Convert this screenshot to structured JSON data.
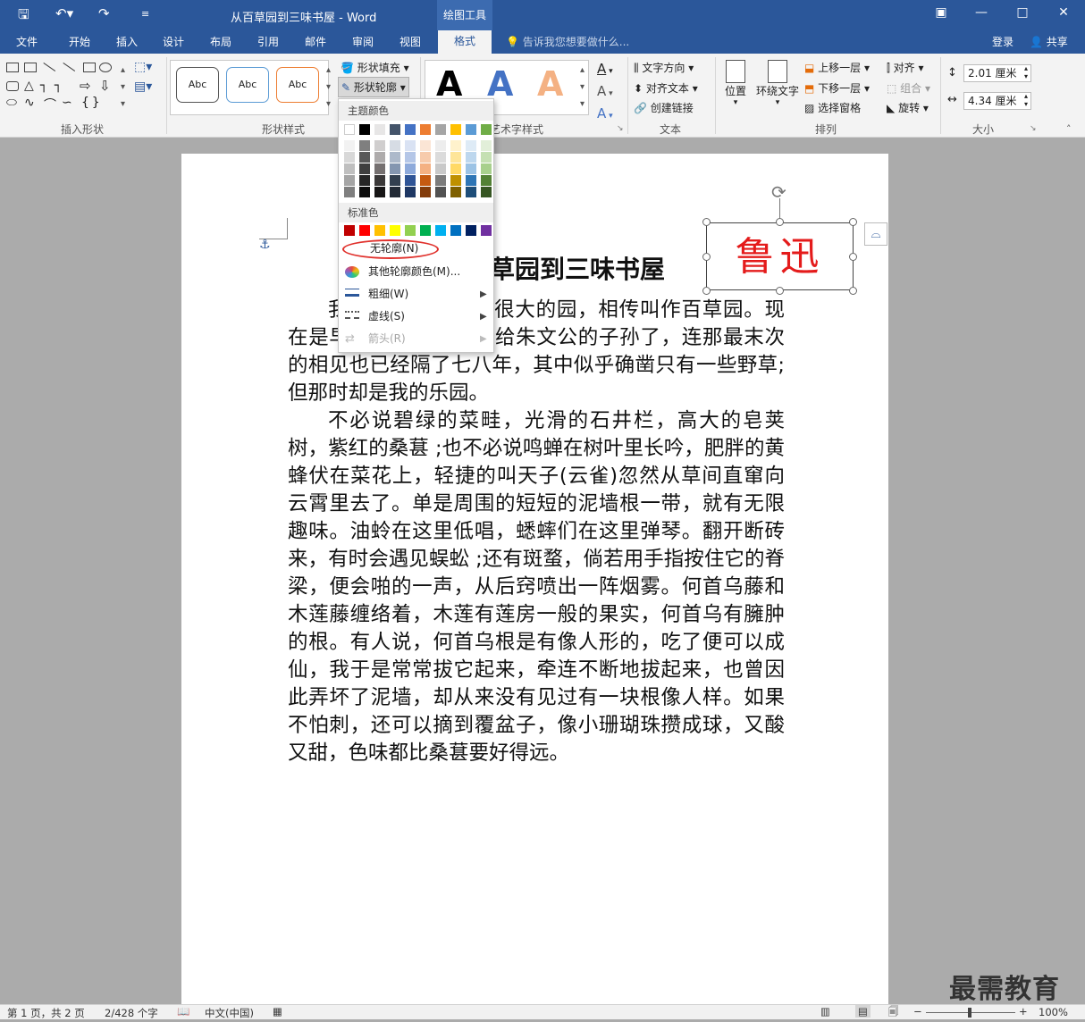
{
  "title_bar": {
    "document_title": "从百草园到三味书屋 - Word",
    "contextual_header": "绘图工具",
    "qat_icons": [
      "save-icon",
      "undo-icon",
      "redo-icon",
      "customize-icon"
    ]
  },
  "tabs": [
    "文件",
    "开始",
    "插入",
    "设计",
    "布局",
    "引用",
    "邮件",
    "审阅",
    "视图"
  ],
  "active_tab": "格式",
  "tell_me": "告诉我您想要做什么...",
  "login": "登录",
  "share": "共享",
  "ribbon": {
    "insert_shapes_label": "插入形状",
    "shape_styles_label": "形状样式",
    "wordart_label": "艺术字样式",
    "text_label": "文本",
    "arrange_label": "排列",
    "size_label": "大小",
    "style_sample": "Abc",
    "style_sample_colors": [
      "#222222",
      "#5b9bd5",
      "#ed7d31"
    ],
    "shape_fill": "形状填充",
    "shape_outline": "形状轮廓",
    "wordart_letter": "A",
    "wordart_colors": [
      "#000000",
      "#4472c4",
      "#f4b183"
    ],
    "text_direction": "文字方向",
    "align_text": "对齐文本",
    "create_link": "创建链接",
    "position": "位置",
    "wrap_text": "环绕文字",
    "bring_forward": "上移一层",
    "send_backward": "下移一层",
    "selection_pane": "选择窗格",
    "align": "对齐",
    "group": "组合",
    "rotate": "旋转",
    "height": "2.01 厘米",
    "width": "4.34 厘米"
  },
  "dropdown": {
    "theme_colors_label": "主题颜色",
    "standard_colors_label": "标准色",
    "theme_top": [
      "#ffffff",
      "#000000",
      "#e7e6e6",
      "#44546a",
      "#4472c4",
      "#ed7d31",
      "#a5a5a5",
      "#ffc000",
      "#5b9bd5",
      "#70ad47"
    ],
    "theme_tints": [
      [
        "#f2f2f2",
        "#7f7f7f",
        "#d0cece",
        "#d6dce4",
        "#d9e2f3",
        "#fbe5d5",
        "#ededed",
        "#fff2cc",
        "#deebf6",
        "#e2efd9"
      ],
      [
        "#d8d8d8",
        "#595959",
        "#aeabab",
        "#adb9ca",
        "#b4c6e7",
        "#f7cbac",
        "#dbdbdb",
        "#fee599",
        "#bdd7ee",
        "#c5e0b3"
      ],
      [
        "#bfbfbf",
        "#3f3f3f",
        "#757070",
        "#8496b0",
        "#8eaadb",
        "#f4b183",
        "#c9c9c9",
        "#ffd965",
        "#9cc3e5",
        "#a8d08d"
      ],
      [
        "#a5a5a5",
        "#262626",
        "#3a3838",
        "#323f4f",
        "#2f5496",
        "#c55a11",
        "#7b7b7b",
        "#bf9000",
        "#2e75b5",
        "#538135"
      ],
      [
        "#7f7f7f",
        "#0c0c0c",
        "#171616",
        "#222a35",
        "#1f3864",
        "#833c0b",
        "#525252",
        "#7f6000",
        "#1e4e79",
        "#375623"
      ]
    ],
    "standard": [
      "#c00000",
      "#ff0000",
      "#ffc000",
      "#ffff00",
      "#92d050",
      "#00b050",
      "#00b0f0",
      "#0070c0",
      "#002060",
      "#7030a0"
    ],
    "no_outline": "无轮廓(N)",
    "more_colors": "其他轮廓颜色(M)...",
    "weight": "粗细(W)",
    "dashes": "虚线(S)",
    "arrows": "箭头(R)",
    "highlight_color": "#e0302b"
  },
  "document": {
    "heading": "草园到三味书屋",
    "textbox_text": "鲁迅",
    "textbox_color": "#e41b1b",
    "paragraphs": [
      "我家的后面有一个很大的园，相传叫作百草园。现在是早已并屋子一起卖给朱文公的子孙了，连那最末次的相见也已经隔了七八年，其中似乎确凿只有一些野草;但那时却是我的乐园。",
      "不必说碧绿的菜畦，光滑的石井栏，高大的皂荚树，紫红的桑葚 ;也不必说鸣蝉在树叶里长吟，肥胖的黄蜂伏在菜花上，轻捷的叫天子(云雀)忽然从草间直窜向云霄里去了。单是周围的短短的泥墙根一带，就有无限趣味。油蛉在这里低唱，蟋蟀们在这里弹琴。翻开断砖来，有时会遇见蜈蚣 ;还有斑蝥，倘若用手指按住它的脊梁，便会啪的一声，从后窍喷出一阵烟雾。何首乌藤和木莲藤缠络着，木莲有莲房一般的果实，何首乌有臃肿的根。有人说，何首乌根是有像人形的，吃了便可以成仙，我于是常常拔它起来，牵连不断地拔起来，也曾因此弄坏了泥墙，却从来没有见过有一块根像人样。如果不怕刺，还可以摘到覆盆子，像小珊瑚珠攒成球，又酸又甜，色味都比桑葚要好得远。"
    ]
  },
  "status": {
    "page": "第 1 页，共 2 页",
    "words": "2/428 个字",
    "language": "中文(中国)",
    "zoom": "100%"
  },
  "watermark": "最需教育"
}
